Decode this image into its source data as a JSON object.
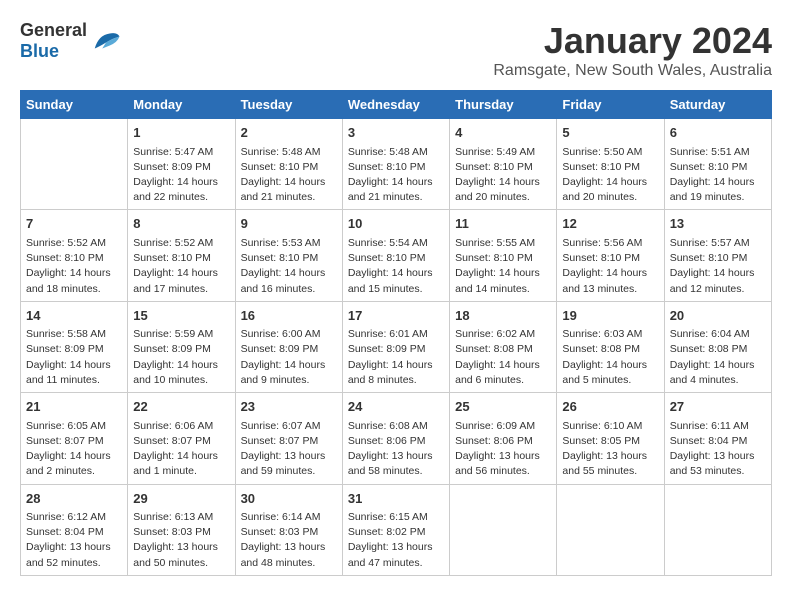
{
  "header": {
    "logo_general": "General",
    "logo_blue": "Blue",
    "month": "January 2024",
    "location": "Ramsgate, New South Wales, Australia"
  },
  "days_of_week": [
    "Sunday",
    "Monday",
    "Tuesday",
    "Wednesday",
    "Thursday",
    "Friday",
    "Saturday"
  ],
  "weeks": [
    [
      {
        "day": "",
        "info": ""
      },
      {
        "day": "1",
        "info": "Sunrise: 5:47 AM\nSunset: 8:09 PM\nDaylight: 14 hours\nand 22 minutes."
      },
      {
        "day": "2",
        "info": "Sunrise: 5:48 AM\nSunset: 8:10 PM\nDaylight: 14 hours\nand 21 minutes."
      },
      {
        "day": "3",
        "info": "Sunrise: 5:48 AM\nSunset: 8:10 PM\nDaylight: 14 hours\nand 21 minutes."
      },
      {
        "day": "4",
        "info": "Sunrise: 5:49 AM\nSunset: 8:10 PM\nDaylight: 14 hours\nand 20 minutes."
      },
      {
        "day": "5",
        "info": "Sunrise: 5:50 AM\nSunset: 8:10 PM\nDaylight: 14 hours\nand 20 minutes."
      },
      {
        "day": "6",
        "info": "Sunrise: 5:51 AM\nSunset: 8:10 PM\nDaylight: 14 hours\nand 19 minutes."
      }
    ],
    [
      {
        "day": "7",
        "info": "Sunrise: 5:52 AM\nSunset: 8:10 PM\nDaylight: 14 hours\nand 18 minutes."
      },
      {
        "day": "8",
        "info": "Sunrise: 5:52 AM\nSunset: 8:10 PM\nDaylight: 14 hours\nand 17 minutes."
      },
      {
        "day": "9",
        "info": "Sunrise: 5:53 AM\nSunset: 8:10 PM\nDaylight: 14 hours\nand 16 minutes."
      },
      {
        "day": "10",
        "info": "Sunrise: 5:54 AM\nSunset: 8:10 PM\nDaylight: 14 hours\nand 15 minutes."
      },
      {
        "day": "11",
        "info": "Sunrise: 5:55 AM\nSunset: 8:10 PM\nDaylight: 14 hours\nand 14 minutes."
      },
      {
        "day": "12",
        "info": "Sunrise: 5:56 AM\nSunset: 8:10 PM\nDaylight: 14 hours\nand 13 minutes."
      },
      {
        "day": "13",
        "info": "Sunrise: 5:57 AM\nSunset: 8:10 PM\nDaylight: 14 hours\nand 12 minutes."
      }
    ],
    [
      {
        "day": "14",
        "info": "Sunrise: 5:58 AM\nSunset: 8:09 PM\nDaylight: 14 hours\nand 11 minutes."
      },
      {
        "day": "15",
        "info": "Sunrise: 5:59 AM\nSunset: 8:09 PM\nDaylight: 14 hours\nand 10 minutes."
      },
      {
        "day": "16",
        "info": "Sunrise: 6:00 AM\nSunset: 8:09 PM\nDaylight: 14 hours\nand 9 minutes."
      },
      {
        "day": "17",
        "info": "Sunrise: 6:01 AM\nSunset: 8:09 PM\nDaylight: 14 hours\nand 8 minutes."
      },
      {
        "day": "18",
        "info": "Sunrise: 6:02 AM\nSunset: 8:08 PM\nDaylight: 14 hours\nand 6 minutes."
      },
      {
        "day": "19",
        "info": "Sunrise: 6:03 AM\nSunset: 8:08 PM\nDaylight: 14 hours\nand 5 minutes."
      },
      {
        "day": "20",
        "info": "Sunrise: 6:04 AM\nSunset: 8:08 PM\nDaylight: 14 hours\nand 4 minutes."
      }
    ],
    [
      {
        "day": "21",
        "info": "Sunrise: 6:05 AM\nSunset: 8:07 PM\nDaylight: 14 hours\nand 2 minutes."
      },
      {
        "day": "22",
        "info": "Sunrise: 6:06 AM\nSunset: 8:07 PM\nDaylight: 14 hours\nand 1 minute."
      },
      {
        "day": "23",
        "info": "Sunrise: 6:07 AM\nSunset: 8:07 PM\nDaylight: 13 hours\nand 59 minutes."
      },
      {
        "day": "24",
        "info": "Sunrise: 6:08 AM\nSunset: 8:06 PM\nDaylight: 13 hours\nand 58 minutes."
      },
      {
        "day": "25",
        "info": "Sunrise: 6:09 AM\nSunset: 8:06 PM\nDaylight: 13 hours\nand 56 minutes."
      },
      {
        "day": "26",
        "info": "Sunrise: 6:10 AM\nSunset: 8:05 PM\nDaylight: 13 hours\nand 55 minutes."
      },
      {
        "day": "27",
        "info": "Sunrise: 6:11 AM\nSunset: 8:04 PM\nDaylight: 13 hours\nand 53 minutes."
      }
    ],
    [
      {
        "day": "28",
        "info": "Sunrise: 6:12 AM\nSunset: 8:04 PM\nDaylight: 13 hours\nand 52 minutes."
      },
      {
        "day": "29",
        "info": "Sunrise: 6:13 AM\nSunset: 8:03 PM\nDaylight: 13 hours\nand 50 minutes."
      },
      {
        "day": "30",
        "info": "Sunrise: 6:14 AM\nSunset: 8:03 PM\nDaylight: 13 hours\nand 48 minutes."
      },
      {
        "day": "31",
        "info": "Sunrise: 6:15 AM\nSunset: 8:02 PM\nDaylight: 13 hours\nand 47 minutes."
      },
      {
        "day": "",
        "info": ""
      },
      {
        "day": "",
        "info": ""
      },
      {
        "day": "",
        "info": ""
      }
    ]
  ]
}
